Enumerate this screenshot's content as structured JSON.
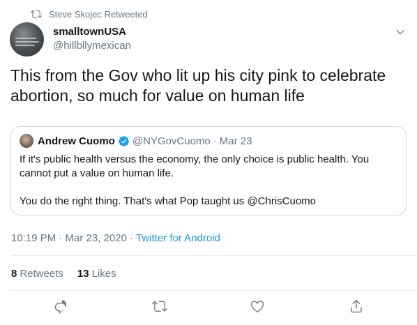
{
  "retweet": {
    "icon": "retweet-icon",
    "text": "Steve Skojec Retweeted"
  },
  "tweet": {
    "author_name": "smalltownUSA",
    "author_handle": "@hillbllymexican",
    "text": "This from the Gov who lit up his city pink to celebrate abortion, so much for value on human life",
    "time": "10:19 PM · Mar 23, 2020",
    "meta_sep": " · ",
    "source": "Twitter for Android"
  },
  "quote": {
    "name": "Andrew Cuomo",
    "handle": "@NYGovCuomo",
    "dot": "·",
    "date": "Mar 23",
    "text_p1": "If it's public health versus the economy, the only choice is public health. You cannot put a value on human life.",
    "text_p2": "You do the right thing. That's what Pop taught us @ChrisCuomo"
  },
  "stats": {
    "retweets_count": "8",
    "retweets_label": "Retweets",
    "likes_count": "13",
    "likes_label": "Likes"
  },
  "colors": {
    "accent": "#1da1f2",
    "link": "#1b95e0",
    "muted": "#657786",
    "text": "#14171a",
    "border": "#ccd6dd"
  }
}
